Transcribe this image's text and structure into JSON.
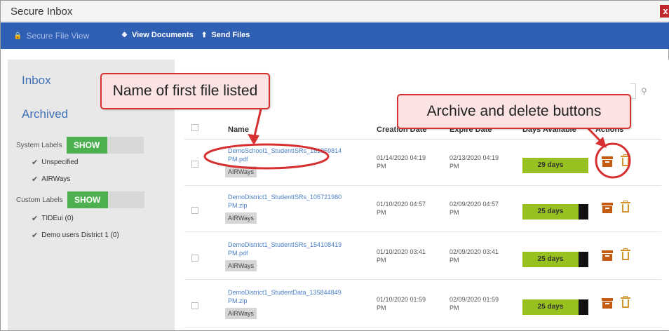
{
  "window": {
    "title": "Secure Inbox",
    "close_label": "x"
  },
  "nav": {
    "secure_view": "Secure File View",
    "view_documents": "View Documents",
    "send_files": "Send Files"
  },
  "sidebar": {
    "inbox": "Inbox",
    "archived": "Archived",
    "system_labels": "System Labels",
    "custom_labels": "Custom Labels",
    "show": "SHOW",
    "system_items": [
      "Unspecified",
      "AIRWays"
    ],
    "custom_items": [
      "TIDEui (0)",
      "Demo users District 1 (0)"
    ]
  },
  "table": {
    "headers": {
      "name": "Name",
      "creation": "Creation Date",
      "expire": "Expire Date",
      "days": "Days Available",
      "actions": "Actions"
    },
    "rows": [
      {
        "name": "DemoSchool1_StudentISRs_161959814 PM.pdf",
        "tag": "AIRWays",
        "created": "01/14/2020 04:19 PM",
        "expires": "02/13/2020 04:19 PM",
        "days": "29 days"
      },
      {
        "name": "DemoDistrict1_StudentISRs_105721980 PM.zip",
        "tag": "AIRWays",
        "created": "01/10/2020 04:57 PM",
        "expires": "02/09/2020 04:57 PM",
        "days": "25 days"
      },
      {
        "name": "DemoDistrict1_StudentISRs_154108419 PM.pdf",
        "tag": "AIRWays",
        "created": "01/10/2020 03:41 PM",
        "expires": "02/09/2020 03:41 PM",
        "days": "25 days"
      },
      {
        "name": "DemoDistrict1_StudentData_135844849 PM.zip",
        "tag": "AIRWays",
        "created": "01/10/2020 01:59 PM",
        "expires": "02/09/2020 01:59 PM",
        "days": "25 days"
      }
    ]
  },
  "annotations": {
    "first_file": "Name of first file listed",
    "archive_delete": "Archive and delete buttons"
  },
  "colors": {
    "nav": "#2f5fb3",
    "toggle_on": "#4caf50",
    "days_bar": "#96c11f",
    "annotation": "#d63031"
  }
}
